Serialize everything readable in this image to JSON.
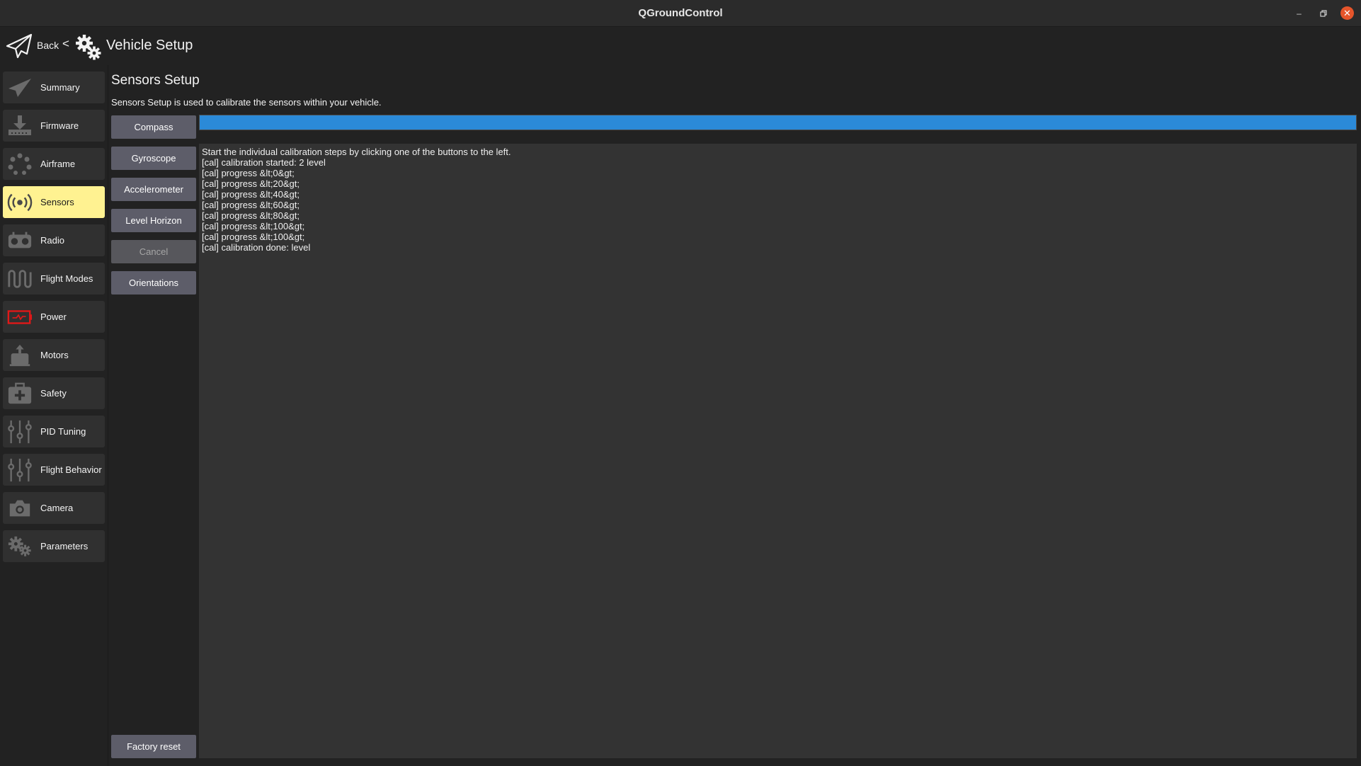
{
  "window": {
    "title": "QGroundControl",
    "controls": {
      "minimize": "–",
      "maximize": "▫",
      "close": "✕"
    }
  },
  "header": {
    "back_label": "Back",
    "separator": "<",
    "page_title": "Vehicle Setup"
  },
  "sidebar": {
    "items": [
      {
        "label": "Summary",
        "icon": "paper-plane-icon",
        "active": false
      },
      {
        "label": "Firmware",
        "icon": "download-icon",
        "active": false
      },
      {
        "label": "Airframe",
        "icon": "airframe-dots-icon",
        "active": false
      },
      {
        "label": "Sensors",
        "icon": "sensor-waves-icon",
        "active": true
      },
      {
        "label": "Radio",
        "icon": "radio-controller-icon",
        "active": false
      },
      {
        "label": "Flight Modes",
        "icon": "wave-icon",
        "active": false
      },
      {
        "label": "Power",
        "icon": "battery-icon",
        "active": false
      },
      {
        "label": "Motors",
        "icon": "motor-icon",
        "active": false
      },
      {
        "label": "Safety",
        "icon": "first-aid-kit-icon",
        "active": false
      },
      {
        "label": "PID Tuning",
        "icon": "sliders-icon",
        "active": false
      },
      {
        "label": "Flight Behavior",
        "icon": "sliders-icon",
        "active": false
      },
      {
        "label": "Camera",
        "icon": "camera-icon",
        "active": false
      },
      {
        "label": "Parameters",
        "icon": "gears-icon",
        "active": false
      }
    ]
  },
  "sensors": {
    "title": "Sensors Setup",
    "description": "Sensors Setup is used to calibrate the sensors within your vehicle.",
    "buttons": {
      "compass": "Compass",
      "gyroscope": "Gyroscope",
      "accelerometer": "Accelerometer",
      "level_horizon": "Level Horizon",
      "cancel": "Cancel",
      "orientations": "Orientations",
      "factory_reset": "Factory reset"
    },
    "progress": 1.0,
    "log": [
      "Start the individual calibration steps by clicking one of the buttons to the left.",
      "[cal] calibration started: 2 level",
      "[cal] progress &lt;0&gt;",
      "[cal] progress &lt;20&gt;",
      "[cal] progress &lt;40&gt;",
      "[cal] progress &lt;60&gt;",
      "[cal] progress &lt;80&gt;",
      "[cal] progress &lt;100&gt;",
      "[cal] progress &lt;100&gt;",
      "[cal] calibration done: level"
    ]
  },
  "colors": {
    "accent_active": "#fff291",
    "progress_fill": "#2b8ad8",
    "button_bg": "#5d5d69",
    "close_button": "#e6552b"
  }
}
